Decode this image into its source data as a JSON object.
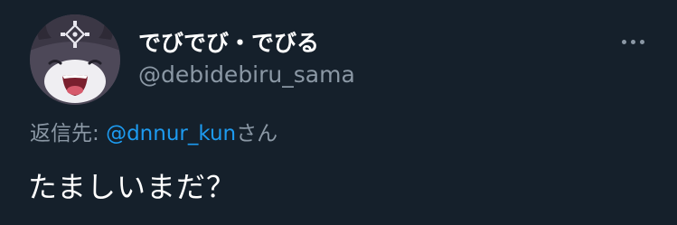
{
  "tweet": {
    "author": {
      "display_name": "でびでび・でびる",
      "handle": "@debidebiru_sama",
      "avatar_icon": "character-avatar-icon"
    },
    "more_icon": "more-options-icon",
    "reply": {
      "prefix": "返信先: ",
      "mention": "@dnnur_kun",
      "suffix": "さん"
    },
    "text": "たましいまだ？"
  },
  "colors": {
    "background": "#15202b",
    "primary_text": "#ffffff",
    "secondary_text": "#8b98a5",
    "link": "#1d9bf0"
  }
}
